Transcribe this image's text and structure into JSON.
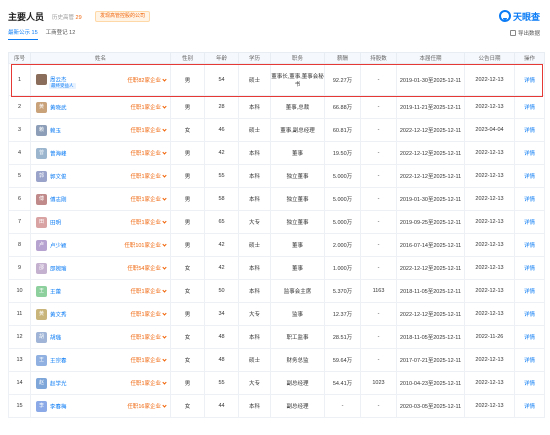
{
  "header": {
    "title": "主要人员",
    "history_label": "历史高管",
    "history_count": "29",
    "warn_label": "发现高管控股的公司",
    "logo_text": "天眼查"
  },
  "tabs": [
    {
      "label": "最新公示 15",
      "active": true
    },
    {
      "label": "工商登记 12",
      "active": false
    }
  ],
  "export_label": "导出数据",
  "columns": [
    "序号",
    "姓名",
    "性别",
    "年龄",
    "学历",
    "职务",
    "薪酬",
    "持股数",
    "本届任期",
    "公告日期",
    "操作"
  ],
  "rows": [
    {
      "idx": "1",
      "avatar": "",
      "avatar_color": "#8a6d5a",
      "name": "周云杰",
      "tag": "最终受益人",
      "ren": "任职82家企业",
      "gender": "男",
      "age": "54",
      "edu": "硕士",
      "title": "董事长,董事,董事会秘书",
      "pay": "92.27万",
      "shares": "-",
      "term": "2019-01-30至2025-12-11",
      "date": "2022-12-13",
      "op": "详情"
    },
    {
      "idx": "2",
      "avatar": "黄",
      "avatar_color": "#c9a27a",
      "name": "黄晓武",
      "tag": "",
      "ren": "任职1家企业",
      "gender": "男",
      "age": "28",
      "edu": "本科",
      "title": "董事,总裁",
      "pay": "66.88万",
      "shares": "-",
      "term": "2019-11-21至2025-12-11",
      "date": "2022-12-13",
      "op": "详情"
    },
    {
      "idx": "3",
      "avatar": "赖",
      "avatar_color": "#8d9fb8",
      "name": "赖玉",
      "tag": "",
      "ren": "任职1家企业",
      "gender": "女",
      "age": "46",
      "edu": "硕士",
      "title": "董事,副总经理",
      "pay": "60.81万",
      "shares": "-",
      "term": "2022-12-12至2025-12-11",
      "date": "2023-04-04",
      "op": "详情"
    },
    {
      "idx": "4",
      "avatar": "曾",
      "avatar_color": "#9bb5cf",
      "name": "曾海峰",
      "tag": "",
      "ren": "任职1家企业",
      "gender": "男",
      "age": "42",
      "edu": "本科",
      "title": "董事",
      "pay": "19.50万",
      "shares": "-",
      "term": "2022-12-12至2025-12-11",
      "date": "2022-12-13",
      "op": "详情"
    },
    {
      "idx": "5",
      "avatar": "郭",
      "avatar_color": "#9aa3c9",
      "name": "郭文俊",
      "tag": "",
      "ren": "任职1家企业",
      "gender": "男",
      "age": "55",
      "edu": "本科",
      "title": "独立董事",
      "pay": "5.000万",
      "shares": "-",
      "term": "2022-12-12至2025-12-11",
      "date": "2022-12-13",
      "op": "详情"
    },
    {
      "idx": "6",
      "avatar": "傅",
      "avatar_color": "#c08a8a",
      "name": "傅志刚",
      "tag": "",
      "ren": "任职1家企业",
      "gender": "男",
      "age": "58",
      "edu": "本科",
      "title": "独立董事",
      "pay": "5.000万",
      "shares": "-",
      "term": "2019-01-30至2025-12-11",
      "date": "2022-12-13",
      "op": "详情"
    },
    {
      "idx": "7",
      "avatar": "田",
      "avatar_color": "#d9a3a3",
      "name": "田明",
      "tag": "",
      "ren": "任职1家企业",
      "gender": "男",
      "age": "65",
      "edu": "大专",
      "title": "独立董事",
      "pay": "5.000万",
      "shares": "-",
      "term": "2019-09-25至2025-12-11",
      "date": "2022-12-13",
      "op": "详情"
    },
    {
      "idx": "8",
      "avatar": "卢",
      "avatar_color": "#b7a3cf",
      "name": "卢少颖",
      "tag": "",
      "ren": "任职101家企业",
      "gender": "男",
      "age": "42",
      "edu": "硕士",
      "title": "董事",
      "pay": "2.000万",
      "shares": "-",
      "term": "2016-07-14至2025-12-11",
      "date": "2022-12-13",
      "op": "详情"
    },
    {
      "idx": "9",
      "avatar": "邵",
      "avatar_color": "#c4b0cf",
      "name": "邵婉瑜",
      "tag": "",
      "ren": "任职54家企业",
      "gender": "女",
      "age": "42",
      "edu": "本科",
      "title": "董事",
      "pay": "1.000万",
      "shares": "-",
      "term": "2022-12-12至2025-12-11",
      "date": "2022-12-13",
      "op": "详情"
    },
    {
      "idx": "10",
      "avatar": "王",
      "avatar_color": "#8ecf9e",
      "name": "王蕾",
      "tag": "",
      "ren": "任职1家企业",
      "gender": "女",
      "age": "50",
      "edu": "本科",
      "title": "监事会主席",
      "pay": "5.370万",
      "shares": "1163",
      "term": "2018-11-05至2025-12-11",
      "date": "2022-12-13",
      "op": "详情"
    },
    {
      "idx": "11",
      "avatar": "黄",
      "avatar_color": "#c9b57a",
      "name": "黄文秀",
      "tag": "",
      "ren": "任职1家企业",
      "gender": "男",
      "age": "34",
      "edu": "大专",
      "title": "监事",
      "pay": "12.37万",
      "shares": "-",
      "term": "2022-12-12至2025-12-11",
      "date": "2022-12-13",
      "op": "详情"
    },
    {
      "idx": "12",
      "avatar": "胡",
      "avatar_color": "#9fb4d6",
      "name": "胡璐",
      "tag": "",
      "ren": "任职1家企业",
      "gender": "女",
      "age": "48",
      "edu": "本科",
      "title": "职工监事",
      "pay": "28.51万",
      "shares": "-",
      "term": "2018-11-05至2025-12-11",
      "date": "2022-11-26",
      "op": "详情"
    },
    {
      "idx": "13",
      "avatar": "王",
      "avatar_color": "#8fb0e0",
      "name": "王宗春",
      "tag": "",
      "ren": "任职1家企业",
      "gender": "女",
      "age": "48",
      "edu": "硕士",
      "title": "财务总监",
      "pay": "59.64万",
      "shares": "-",
      "term": "2017-07-21至2025-12-11",
      "date": "2022-12-13",
      "op": "详情"
    },
    {
      "idx": "14",
      "avatar": "赵",
      "avatar_color": "#7fa6d9",
      "name": "赵学光",
      "tag": "",
      "ren": "任职1家企业",
      "gender": "男",
      "age": "55",
      "edu": "大专",
      "title": "副总经理",
      "pay": "54.41万",
      "shares": "1023",
      "term": "2010-04-23至2025-12-11",
      "date": "2022-12-13",
      "op": "详情"
    },
    {
      "idx": "15",
      "avatar": "李",
      "avatar_color": "#8aa9e6",
      "name": "李春梅",
      "tag": "",
      "ren": "任职16家企业",
      "gender": "女",
      "age": "44",
      "edu": "本科",
      "title": "副总经理",
      "pay": "-",
      "shares": "-",
      "term": "2020-03-05至2025-12-11",
      "date": "2022-12-13",
      "op": "详情"
    }
  ]
}
